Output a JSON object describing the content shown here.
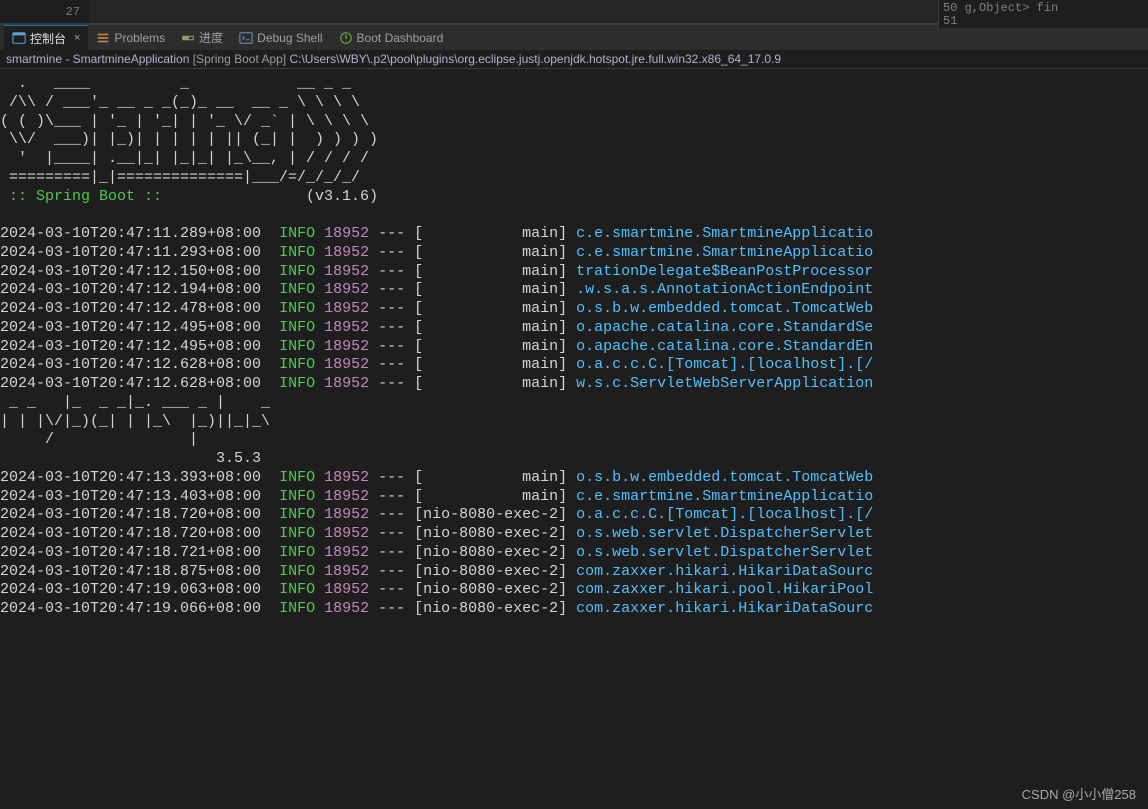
{
  "top": {
    "line_num": "27",
    "right_snippet": "50 g,Object> fin\n51"
  },
  "tabs": [
    {
      "label": "控制台",
      "icon": "terminal-icon",
      "active": true,
      "closable": true
    },
    {
      "label": "Problems",
      "icon": "problems-icon",
      "active": false
    },
    {
      "label": "进度",
      "icon": "progress-icon",
      "active": false
    },
    {
      "label": "Debug Shell",
      "icon": "debug-shell-icon",
      "active": false
    },
    {
      "label": "Boot Dashboard",
      "icon": "boot-dashboard-icon",
      "active": false
    }
  ],
  "launch": {
    "prefix": "smartmine - SmartmineApplication ",
    "gray": "[Spring Boot App] ",
    "path": "C:\\Users\\WBY\\.p2\\pool\\plugins\\org.eclipse.justj.openjdk.hotspot.jre.full.win32.x86_64_17.0.9"
  },
  "ascii_spring": [
    "  .   ____          _            __ _ _",
    " /\\\\ / ___'_ __ _ _(_)_ __  __ _ \\ \\ \\ \\",
    "( ( )\\___ | '_ | '_| | '_ \\/ _` | \\ \\ \\ \\",
    " \\\\/  ___)| |_)| | | | | || (_| |  ) ) ) )",
    "  '  |____| .__|_| |_|_| |_\\__, | / / / /",
    " =========|_|==============|___/=/_/_/_/"
  ],
  "boot_line": {
    "label": " :: Spring Boot :: ",
    "version": "               (v3.1.6)"
  },
  "logs1": [
    {
      "ts": "2024-03-10T20:47:11.289+08:00",
      "lvl": "INFO",
      "pid": "18952",
      "thread": "           main",
      "logger": "c.e.smartmine.SmartmineApplicatio"
    },
    {
      "ts": "2024-03-10T20:47:11.293+08:00",
      "lvl": "INFO",
      "pid": "18952",
      "thread": "           main",
      "logger": "c.e.smartmine.SmartmineApplicatio"
    },
    {
      "ts": "2024-03-10T20:47:12.150+08:00",
      "lvl": "INFO",
      "pid": "18952",
      "thread": "           main",
      "logger": "trationDelegate$BeanPostProcessor"
    },
    {
      "ts": "2024-03-10T20:47:12.194+08:00",
      "lvl": "INFO",
      "pid": "18952",
      "thread": "           main",
      "logger": ".w.s.a.s.AnnotationActionEndpoint"
    },
    {
      "ts": "2024-03-10T20:47:12.478+08:00",
      "lvl": "INFO",
      "pid": "18952",
      "thread": "           main",
      "logger": "o.s.b.w.embedded.tomcat.TomcatWeb"
    },
    {
      "ts": "2024-03-10T20:47:12.495+08:00",
      "lvl": "INFO",
      "pid": "18952",
      "thread": "           main",
      "logger": "o.apache.catalina.core.StandardSe"
    },
    {
      "ts": "2024-03-10T20:47:12.495+08:00",
      "lvl": "INFO",
      "pid": "18952",
      "thread": "           main",
      "logger": "o.apache.catalina.core.StandardEn"
    },
    {
      "ts": "2024-03-10T20:47:12.628+08:00",
      "lvl": "INFO",
      "pid": "18952",
      "thread": "           main",
      "logger": "o.a.c.c.C.[Tomcat].[localhost].[/"
    },
    {
      "ts": "2024-03-10T20:47:12.628+08:00",
      "lvl": "INFO",
      "pid": "18952",
      "thread": "           main",
      "logger": "w.s.c.ServletWebServerApplication"
    }
  ],
  "ascii_mp": [
    " _ _   |_  _ _|_. ___ _ |    _ ",
    "| | |\\/|_)(_| | |_\\  |_)||_|_\\ ",
    "     /               |         ",
    "                        3.5.3 "
  ],
  "logs2": [
    {
      "ts": "2024-03-10T20:47:13.393+08:00",
      "lvl": "INFO",
      "pid": "18952",
      "thread": "           main",
      "logger": "o.s.b.w.embedded.tomcat.TomcatWeb"
    },
    {
      "ts": "2024-03-10T20:47:13.403+08:00",
      "lvl": "INFO",
      "pid": "18952",
      "thread": "           main",
      "logger": "c.e.smartmine.SmartmineApplicatio"
    },
    {
      "ts": "2024-03-10T20:47:18.720+08:00",
      "lvl": "INFO",
      "pid": "18952",
      "thread": "nio-8080-exec-2",
      "logger": "o.a.c.c.C.[Tomcat].[localhost].[/"
    },
    {
      "ts": "2024-03-10T20:47:18.720+08:00",
      "lvl": "INFO",
      "pid": "18952",
      "thread": "nio-8080-exec-2",
      "logger": "o.s.web.servlet.DispatcherServlet"
    },
    {
      "ts": "2024-03-10T20:47:18.721+08:00",
      "lvl": "INFO",
      "pid": "18952",
      "thread": "nio-8080-exec-2",
      "logger": "o.s.web.servlet.DispatcherServlet"
    },
    {
      "ts": "2024-03-10T20:47:18.875+08:00",
      "lvl": "INFO",
      "pid": "18952",
      "thread": "nio-8080-exec-2",
      "logger": "com.zaxxer.hikari.HikariDataSourc"
    },
    {
      "ts": "2024-03-10T20:47:19.063+08:00",
      "lvl": "INFO",
      "pid": "18952",
      "thread": "nio-8080-exec-2",
      "logger": "com.zaxxer.hikari.pool.HikariPool"
    },
    {
      "ts": "2024-03-10T20:47:19.066+08:00",
      "lvl": "INFO",
      "pid": "18952",
      "thread": "nio-8080-exec-2",
      "logger": "com.zaxxer.hikari.HikariDataSourc"
    }
  ],
  "watermark": "CSDN @小小僧258"
}
